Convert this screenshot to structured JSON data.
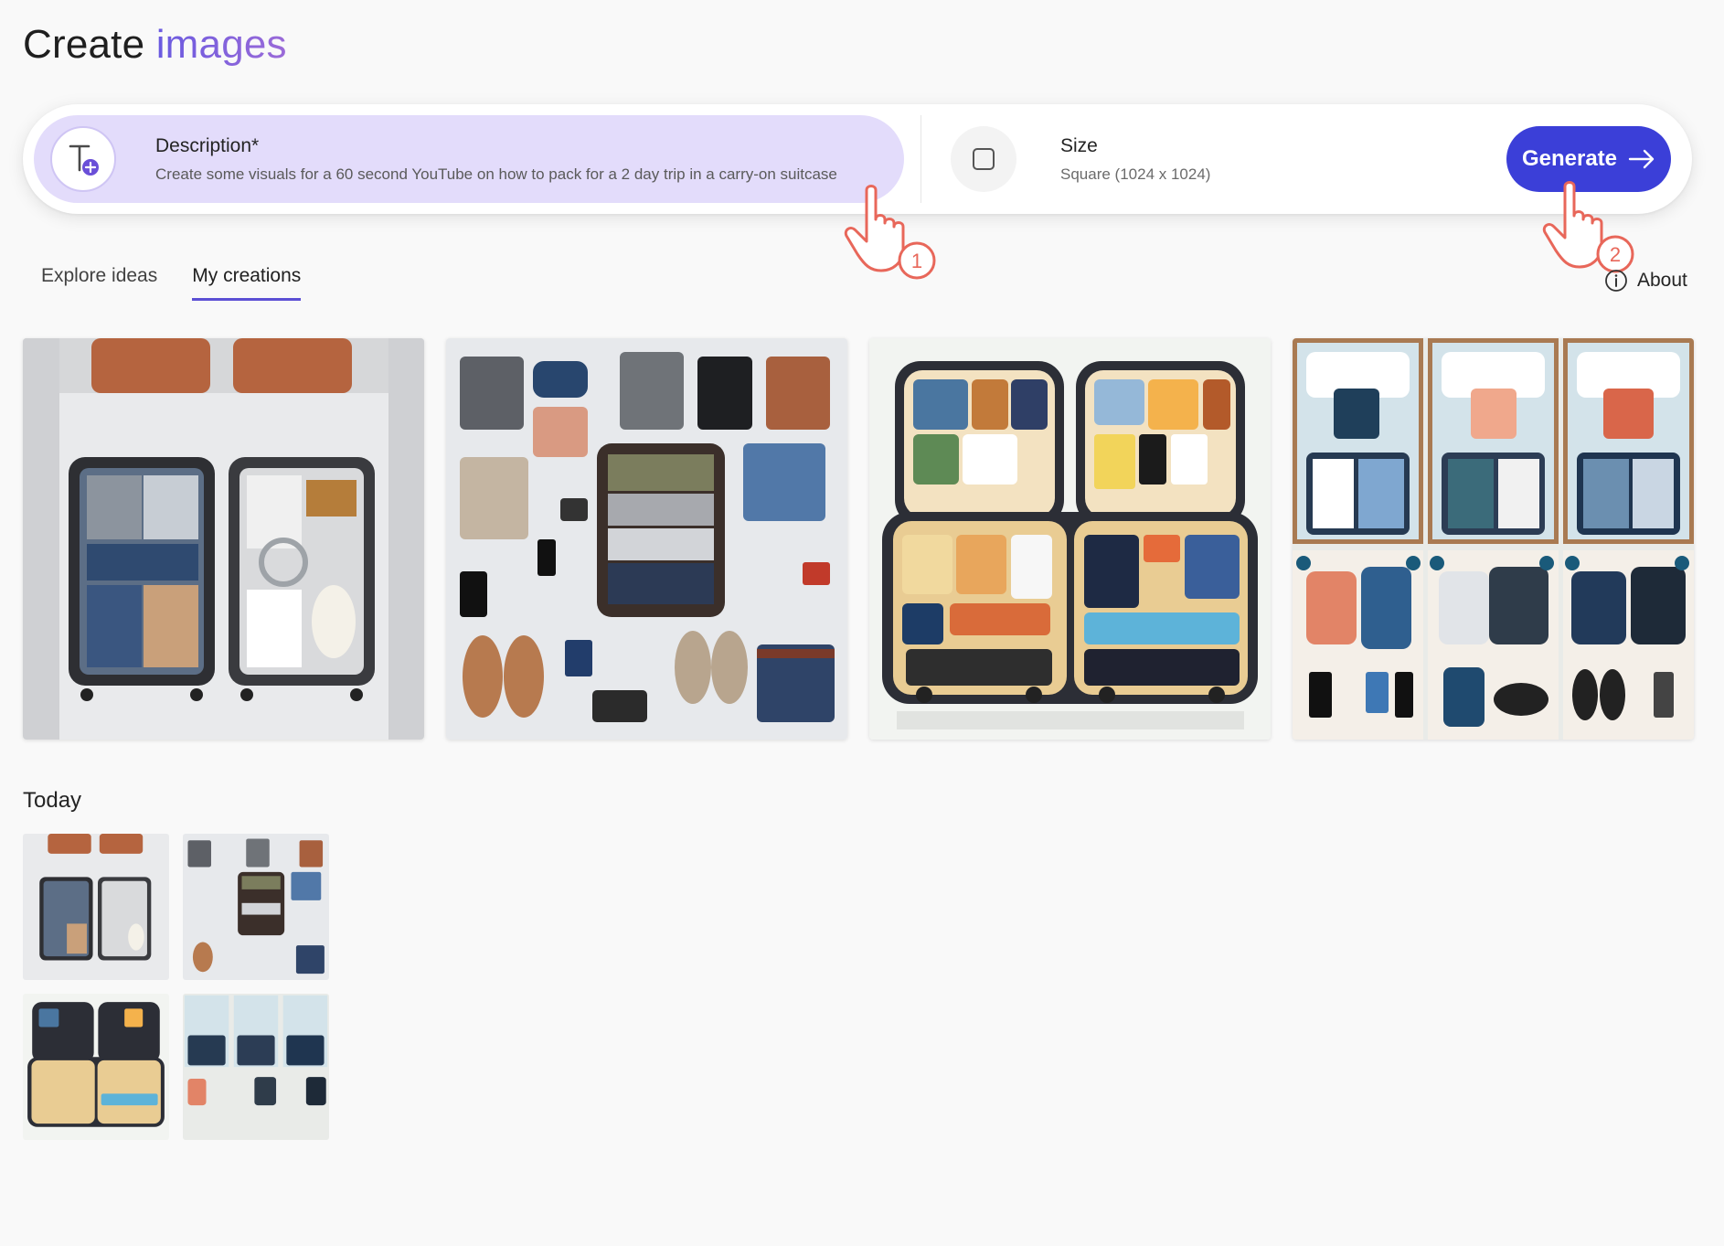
{
  "page": {
    "title_main": "Create",
    "title_accent": "images"
  },
  "prompt": {
    "description_label": "Description*",
    "description_value": "Create some visuals for a 60 second YouTube on how to pack for a 2 day trip in a carry-on suitcase",
    "description_icon": "text-add-icon",
    "size_label": "Size",
    "size_value": "Square (1024 x 1024)",
    "size_icon": "square-icon",
    "generate_label": "Generate",
    "generate_icon": "arrow-right-icon"
  },
  "annotations": {
    "step_1": "1",
    "step_2": "2"
  },
  "tabs": [
    {
      "label": "Explore ideas",
      "active": false
    },
    {
      "label": "My creations",
      "active": true
    }
  ],
  "about": {
    "label": "About",
    "icon": "info-icon"
  },
  "creations": [
    {
      "subject": "photo: open carry-on suitcase on bed with folded clothes"
    },
    {
      "subject": "photo: flat lay of clothes, shoes and open suitcase"
    },
    {
      "subject": "illustration: labeled packing diagram of open suitcase"
    },
    {
      "subject": "illustration: step-by-step packing panels"
    }
  ],
  "today": {
    "heading": "Today"
  },
  "colors": {
    "accent": "#3b3fd8",
    "description_bg": "#e3dcfb",
    "tab_underline": "#5b4fd4",
    "pointer": "#e8675a"
  }
}
